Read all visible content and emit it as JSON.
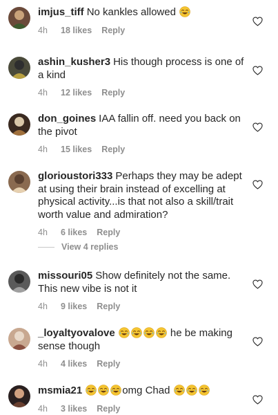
{
  "comments": [
    {
      "username": "imjus_tiff",
      "text_before": "No kankles allowed",
      "emoji_count": 1,
      "text_after": "",
      "age": "4h",
      "likes": "18 likes",
      "reply": "Reply"
    },
    {
      "username": "ashin_kusher3",
      "text_before": "His though process is one of a kind",
      "emoji_count": 0,
      "text_after": "",
      "age": "4h",
      "likes": "12 likes",
      "reply": "Reply"
    },
    {
      "username": "don_goines",
      "text_before": "IAA fallin off. need you back on the pivot",
      "emoji_count": 0,
      "text_after": "",
      "age": "4h",
      "likes": "15 likes",
      "reply": "Reply"
    },
    {
      "username": "glorioustori333",
      "text_before": "Perhaps they may be adept at using their brain instead of excelling at physical activity...is that not also a skill/trait worth value and admiration?",
      "emoji_count": 0,
      "text_after": "",
      "age": "4h",
      "likes": "6 likes",
      "reply": "Reply"
    },
    {
      "username": "missouri05",
      "text_before": "Show definitely not the same. This new vibe is not it",
      "emoji_count": 0,
      "text_after": "",
      "age": "4h",
      "likes": "9 likes",
      "reply": "Reply"
    },
    {
      "username": "_loyaltyovalove",
      "text_before": "",
      "emoji_count": 4,
      "text_after": " he be making sense though",
      "age": "4h",
      "likes": "4 likes",
      "reply": "Reply"
    },
    {
      "username": "msmia21",
      "text_before": "",
      "emoji_count": 3,
      "text_after": "omg Chad ",
      "emoji_after_count": 3,
      "age": "4h",
      "likes": "3 likes",
      "reply": "Reply"
    }
  ],
  "view_replies": "View 4 replies",
  "icons": {
    "like": "heart-outline-icon",
    "emoji": "face-with-tears-of-joy-emoji"
  },
  "colors": {
    "text": "#262626",
    "muted": "#8e8e8e",
    "background": "#ffffff"
  }
}
